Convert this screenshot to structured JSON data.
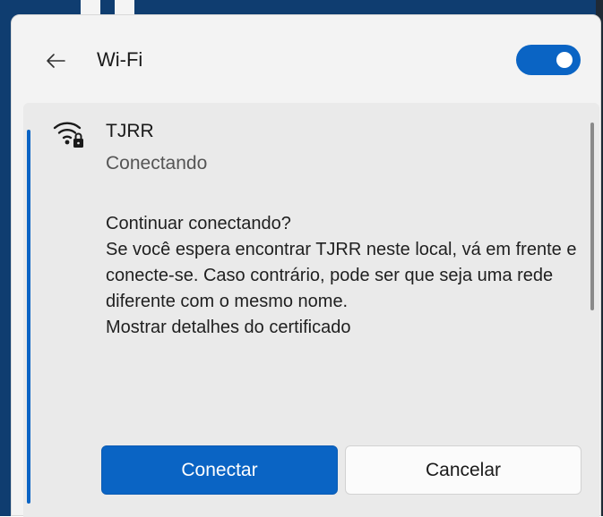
{
  "header": {
    "back_icon": "arrow-left-icon",
    "title": "Wi-Fi",
    "wifi_toggle_state": "on"
  },
  "network": {
    "icon": "wifi-secured-lock-icon",
    "name": "TJRR",
    "status": "Conectando"
  },
  "message": {
    "question": "Continuar conectando?",
    "body": "Se você espera encontrar TJRR   neste local, vá em frente e conecte-se. Caso contrário, pode ser que seja uma rede diferente com o mesmo nome.",
    "certificate_link": "Mostrar detalhes do certificado"
  },
  "buttons": {
    "connect": "Conectar",
    "cancel": "Cancelar"
  },
  "colors": {
    "accent": "#0a64c4",
    "panel_bg": "#f3f3f3",
    "card_bg": "#eaeaea"
  }
}
